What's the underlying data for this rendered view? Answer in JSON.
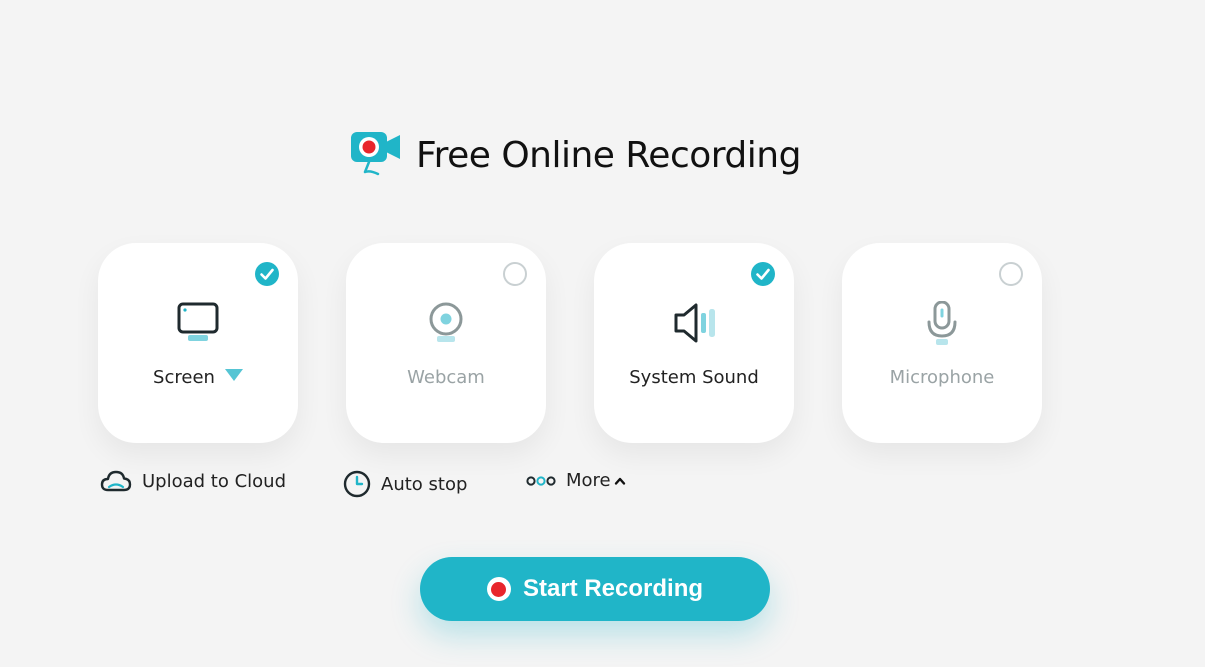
{
  "header": {
    "title": "Free Online Recording",
    "logo_icon": "camera-record-icon"
  },
  "cards": [
    {
      "label": "Screen",
      "checked": true,
      "icon": "monitor-icon"
    },
    {
      "label": "Webcam",
      "checked": false,
      "icon": "webcam-icon"
    },
    {
      "label": "System Sound",
      "checked": true,
      "icon": "speaker-icon"
    },
    {
      "label": "Microphone",
      "checked": false,
      "icon": "microphone-icon"
    }
  ],
  "options": {
    "upload": "Upload to Cloud",
    "autostop": "Auto stop",
    "more": "More"
  },
  "start_button": {
    "label": "Start Recording"
  },
  "colors": {
    "accent": "#20b5c8",
    "record_red": "#e8262c",
    "background": "#f4f4f4"
  }
}
